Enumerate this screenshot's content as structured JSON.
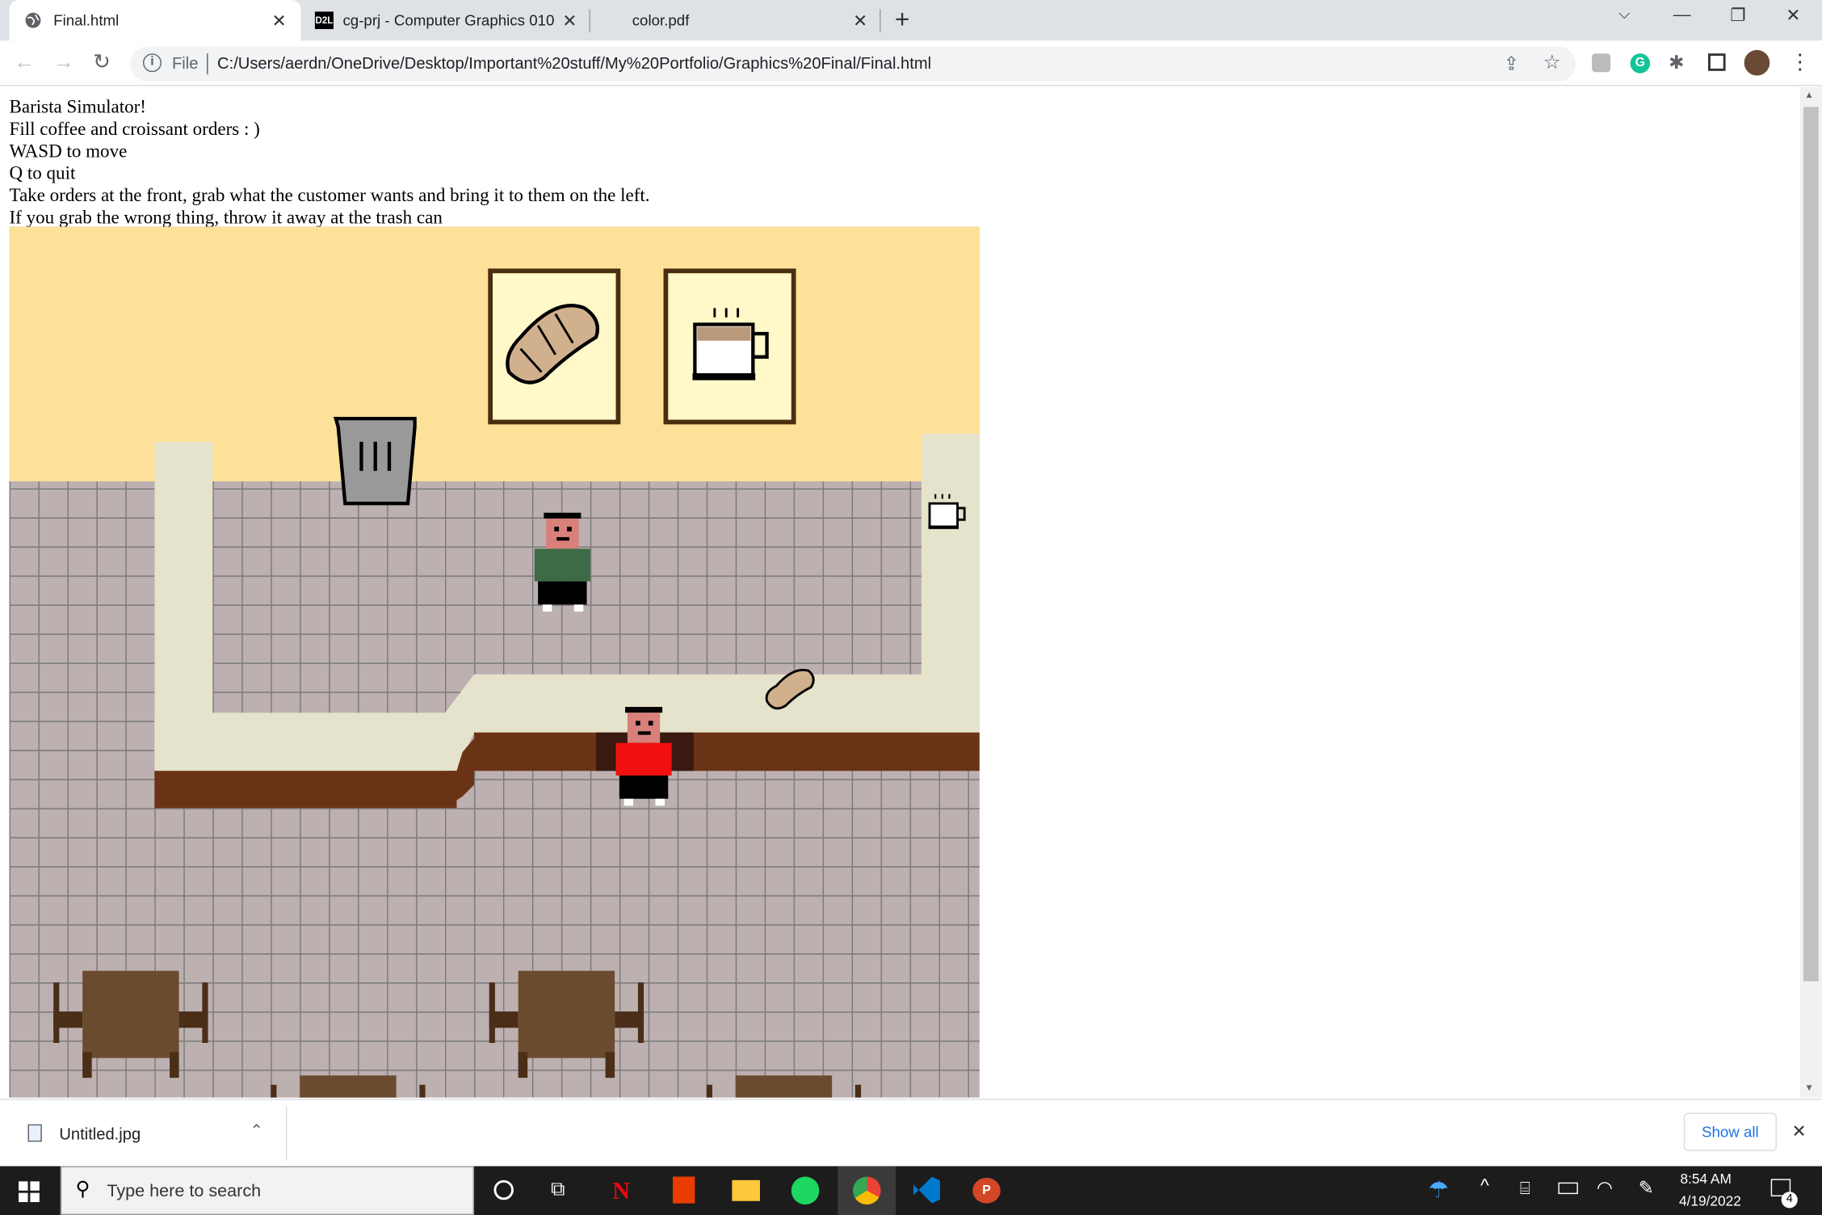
{
  "tabs": [
    {
      "title": "Final.html",
      "active": true
    },
    {
      "title": "cg-prj - Computer Graphics 010",
      "favicon": "D2L",
      "active": false
    },
    {
      "title": "color.pdf",
      "active": false
    }
  ],
  "omnibox": {
    "scheme_label": "File",
    "url": "C:/Users/aerdn/OneDrive/Desktop/Important%20stuff/My%20Portfolio/Graphics%20Final/Final.html"
  },
  "page": {
    "instructions": [
      "Barista Simulator!",
      "Fill coffee and croissant orders : )",
      "WASD to move",
      "Q to quit",
      "Take orders at the front, grab what the customer wants and bring it to them on the left.",
      "If you grab the wrong thing, throw it away at the trash can"
    ]
  },
  "game_colors": {
    "wall": "#fee198",
    "floor": "#bcb0b0",
    "grout": "#7a7a7a",
    "counter_top": "#e5e3cb",
    "counter_front": "#6b3316",
    "shirt_customer": "#3d6b45",
    "shirt_barista": "#f20f0f",
    "frame": "#4a2e10",
    "frame_bg": "#fff8c8",
    "table": "#6b4b2e"
  },
  "download": {
    "filename": "Untitled.jpg",
    "show_all": "Show all"
  },
  "taskbar": {
    "search_placeholder": "Type here to search",
    "time": "8:54 AM",
    "date": "4/19/2022",
    "notification_count": "4"
  },
  "icons": [
    "globe-icon",
    "d2l-icon",
    "close-icon",
    "new-tab-icon",
    "back-icon",
    "forward-icon",
    "reload-icon",
    "info-icon",
    "share-icon",
    "star-icon",
    "extension-icon",
    "grammarly-icon",
    "puzzle-icon",
    "side-panel-icon",
    "avatar",
    "menu-icon",
    "image-file-icon",
    "chevron-up-icon",
    "windows-start-icon",
    "search-icon",
    "cortana-icon",
    "task-view-icon",
    "netflix-icon",
    "office-icon",
    "file-explorer-icon",
    "spotify-icon",
    "chrome-icon",
    "vscode-icon",
    "powerpoint-icon",
    "weather-icon",
    "battery-icon",
    "wifi-icon",
    "pen-icon",
    "notification-icon"
  ]
}
